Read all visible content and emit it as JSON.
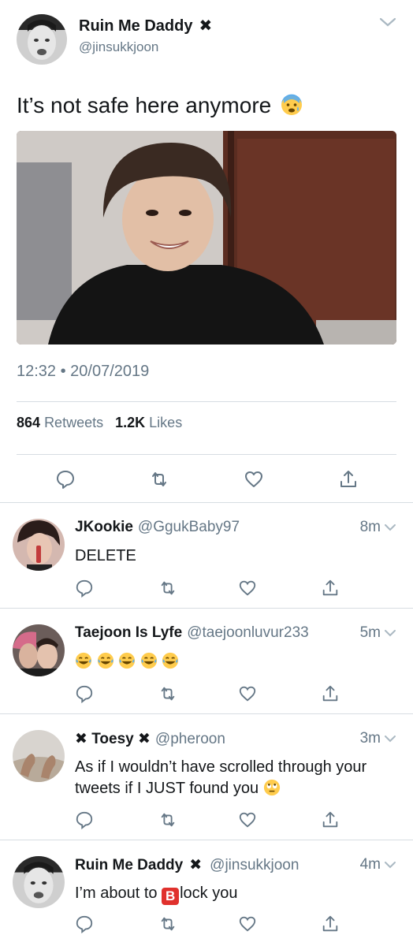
{
  "main_tweet": {
    "display_name": "Ruin Me Daddy",
    "name_badge": "✖",
    "handle": "@jinsukkjoon",
    "text": "It’s not safe here anymore",
    "text_emoji": "anxious-face-emoji",
    "timestamp": "12:32 • 20/07/2019",
    "retweets_count": "864",
    "retweets_label": "Retweets",
    "likes_count": "1.2K",
    "likes_label": "Likes"
  },
  "replies": [
    {
      "display_name": "JKookie",
      "handle": "@GgukBaby97",
      "time": "8m",
      "text": "DELETE"
    },
    {
      "display_name": "Taejoon Is Lyfe",
      "handle": "@taejoonluvur233",
      "time": "5m",
      "emojis": [
        "laughing-crying-emoji",
        "laughing-crying-emoji",
        "laughing-crying-emoji",
        "laughing-crying-emoji",
        "laughing-crying-emoji"
      ]
    },
    {
      "display_name": "✖ Toesy ✖",
      "handle": "@pheroon",
      "time": "3m",
      "text": "As if I wouldn’t have scrolled through your tweets if I JUST found you",
      "text_emoji": "eye-roll-emoji"
    },
    {
      "display_name": "Ruin Me Daddy",
      "name_badge": "✖",
      "handle": "@jinsukkjoon",
      "time": "4m",
      "text_before": "I’m about to",
      "b_block": "B",
      "text_after": "lock you"
    }
  ],
  "colors": {
    "text": "#14171a",
    "muted": "#657786",
    "divider": "#d7dde2",
    "block_red": "#e0312d"
  }
}
